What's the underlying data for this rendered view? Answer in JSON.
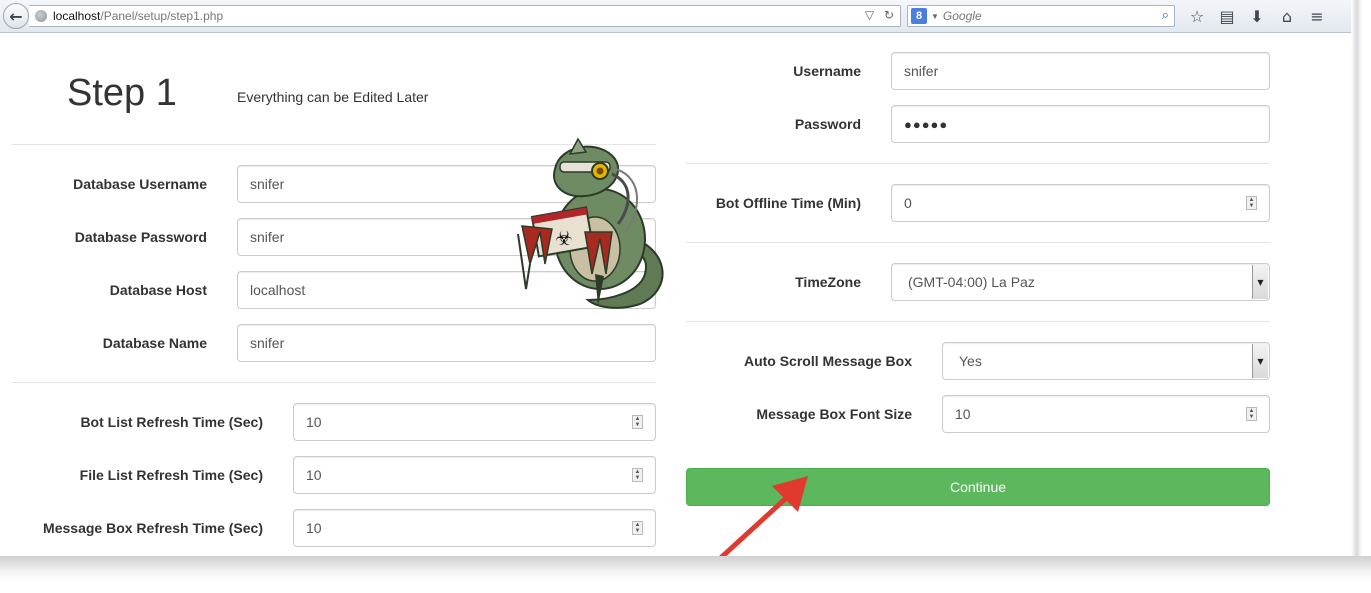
{
  "browser": {
    "url_host": "localhost",
    "url_path": "/Panel/setup/step1.php",
    "search_engine_letter": "8",
    "search_placeholder": "Google"
  },
  "header": {
    "title": "Step 1",
    "subtitle": "Everything can be Edited Later"
  },
  "database": {
    "username_label": "Database Username",
    "username_value": "snifer",
    "password_label": "Database Password",
    "password_value": "snifer",
    "host_label": "Database Host",
    "host_value": "localhost",
    "name_label": "Database Name",
    "name_value": "snifer"
  },
  "refresh": {
    "bot_list_label": "Bot List Refresh Time (Sec)",
    "bot_list_value": "10",
    "file_list_label": "File List Refresh Time (Sec)",
    "file_list_value": "10",
    "message_box_label": "Message Box Refresh Time (Sec)",
    "message_box_value": "10"
  },
  "account": {
    "username_label": "Username",
    "username_value": "snifer",
    "password_label": "Password",
    "password_value": "●●●●●"
  },
  "bot": {
    "offline_label": "Bot Offline Time (Min)",
    "offline_value": "0"
  },
  "timezone": {
    "label": "TimeZone",
    "selected": "(GMT-04:00) La Paz"
  },
  "message_box": {
    "autoscroll_label": "Auto Scroll Message Box",
    "autoscroll_selected": "Yes",
    "font_size_label": "Message Box Font Size",
    "font_size_value": "10"
  },
  "actions": {
    "continue_label": "Continue",
    "continue_color": "#5cb85c"
  },
  "annotation": {
    "arrow_color": "#e03a2f"
  }
}
